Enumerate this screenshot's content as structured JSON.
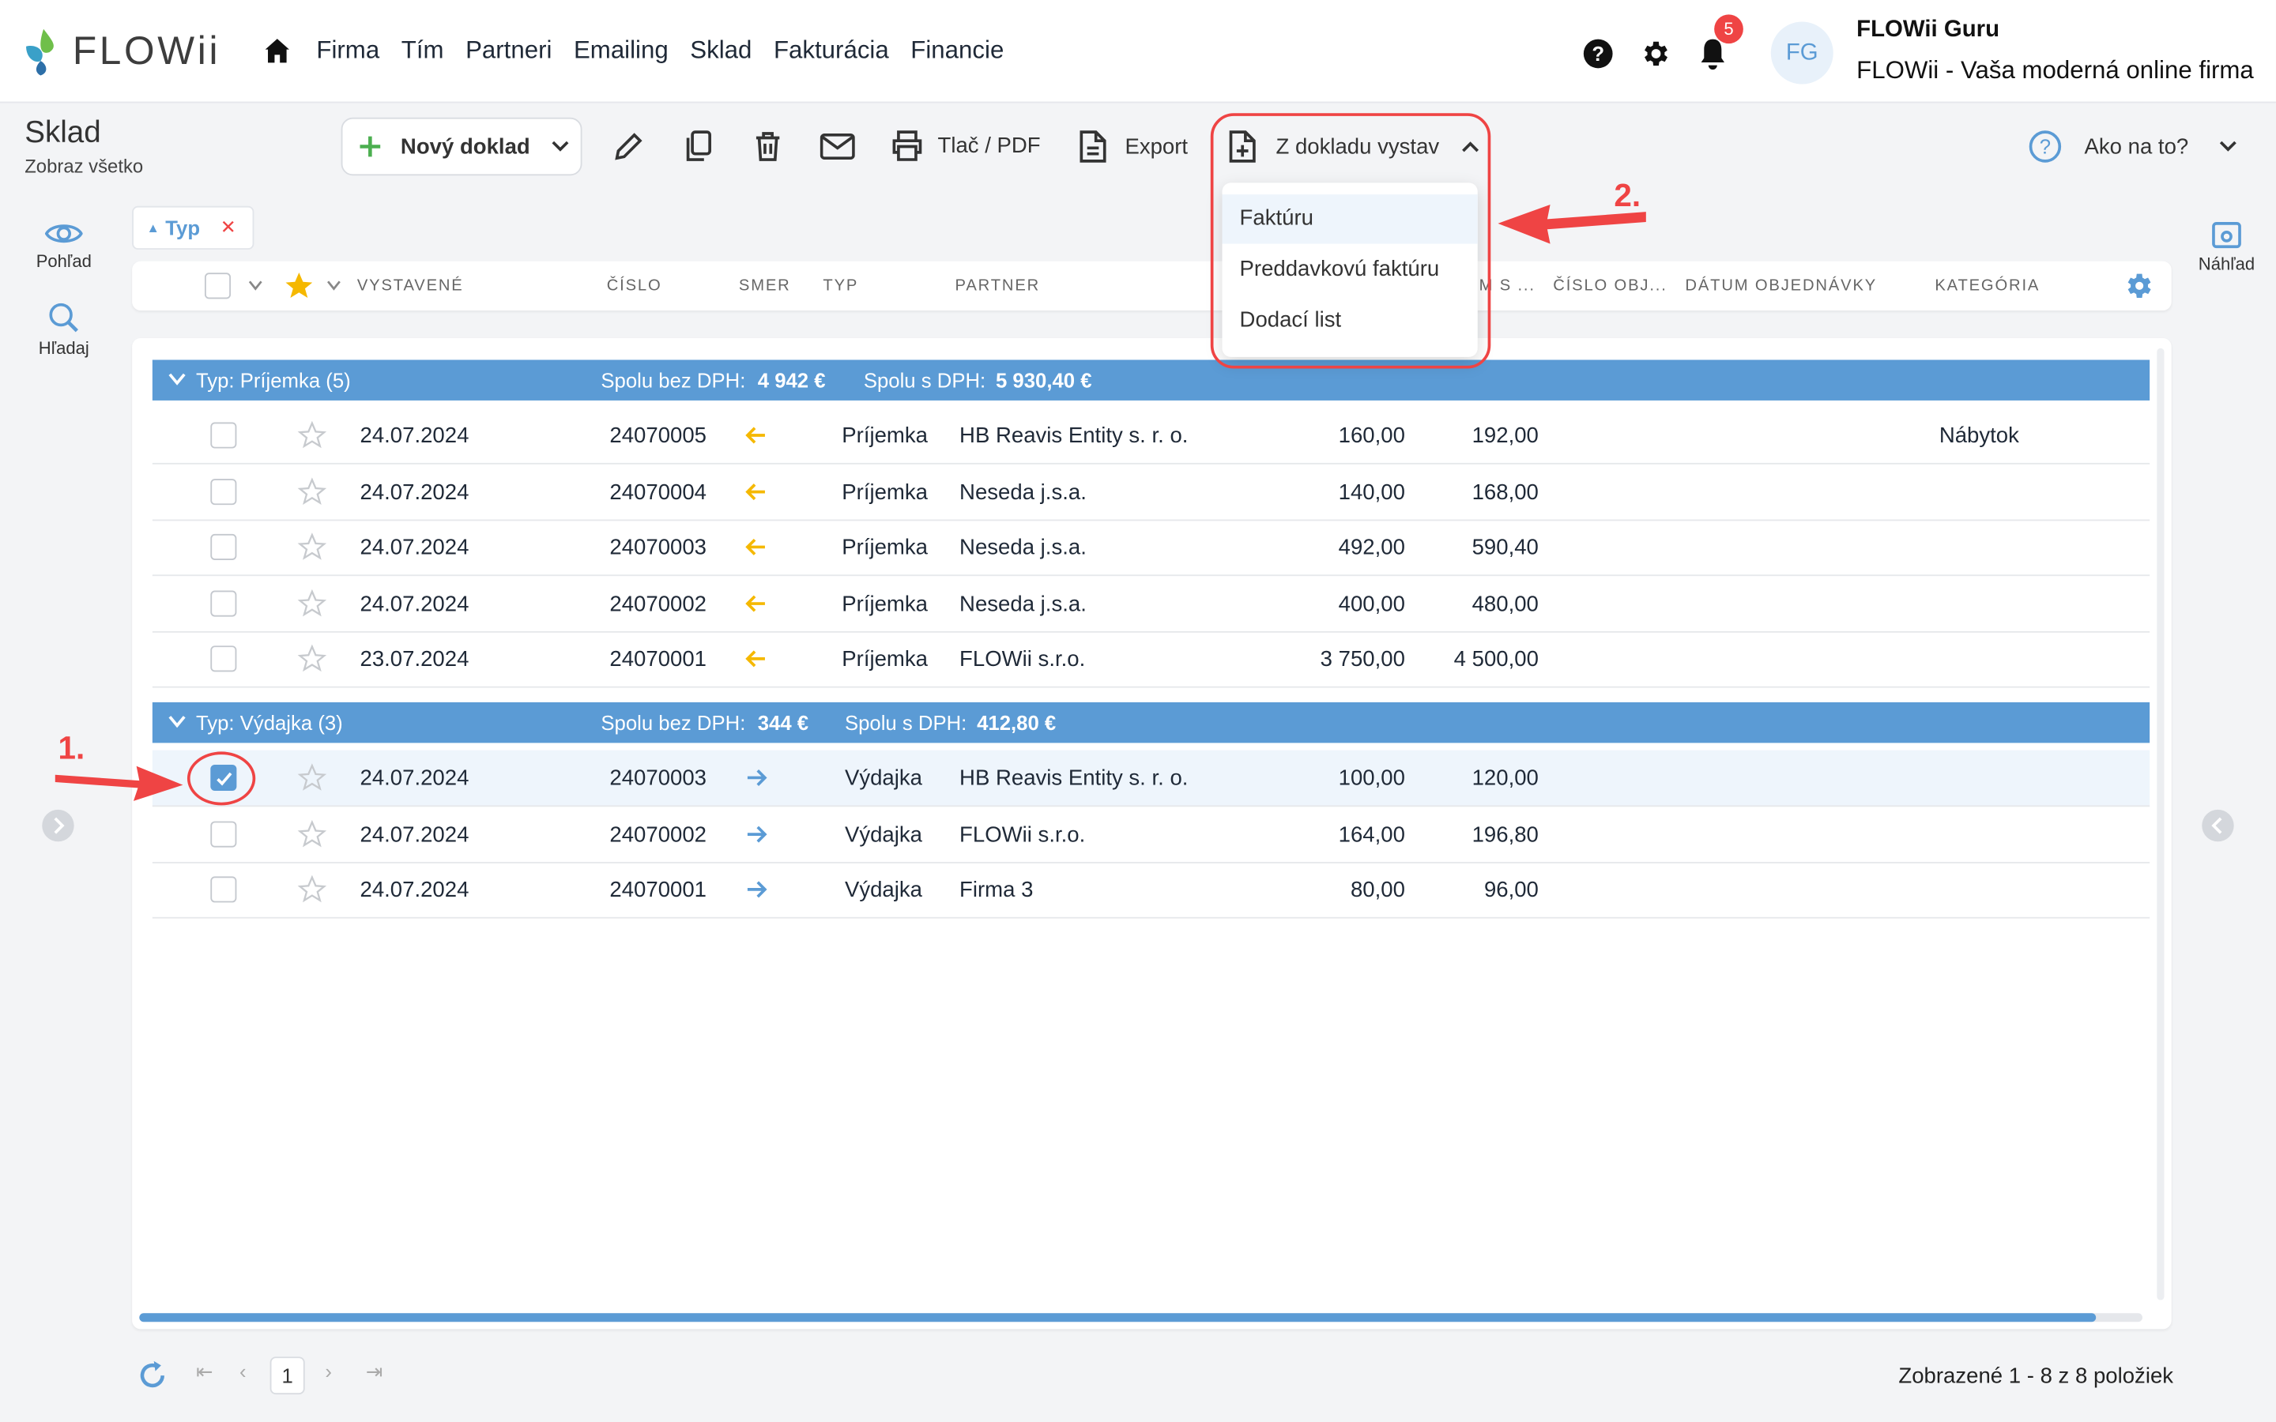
{
  "app": {
    "logo_text": "FLOWii",
    "nav": [
      "Firma",
      "Tím",
      "Partneri",
      "Emailing",
      "Sklad",
      "Fakturácia",
      "Financie"
    ],
    "notifications_count": "5",
    "avatar_initials": "FG",
    "user_name": "FLOWii Guru",
    "user_org": "FLOWii - Vaša moderná online firma"
  },
  "page": {
    "title": "Sklad",
    "subtitle": "Zobraz všetko"
  },
  "toolbar": {
    "new_doc": "Nový doklad",
    "print": "Tlač / PDF",
    "export": "Export",
    "from_doc": "Z dokladu vystav",
    "help": "Ako na to?"
  },
  "dropdown": {
    "items": [
      "Faktúru",
      "Preddavkovú faktúru",
      "Dodací list"
    ]
  },
  "rail": {
    "view": "Pohľad",
    "search": "Hľadaj",
    "preview": "Náhľad"
  },
  "filter_chip": {
    "label": "Typ"
  },
  "columns": {
    "issued": "VYSTAVENÉ",
    "number": "ČÍSLO",
    "direction": "SMER",
    "type": "TYP",
    "partner": "PARTNER",
    "with_vat_trunc": "M S ...",
    "order_no": "ČÍSLO OBJ...",
    "order_date": "DÁTUM OBJEDNÁVKY",
    "category": "KATEGÓRIA"
  },
  "groups": [
    {
      "label": "Typ: Príjemka (5)",
      "sum_no_vat_label": "Spolu bez DPH:",
      "sum_no_vat": "4 942 €",
      "sum_vat_label": "Spolu s DPH:",
      "sum_vat": "5 930,40 €",
      "rows": [
        {
          "date": "24.07.2024",
          "number": "24070005",
          "dir": "in",
          "type": "Príjemka",
          "partner": "HB Reavis Entity s. r. o.",
          "no_vat": "160,00",
          "vat": "192,00",
          "category": "Nábytok",
          "selected": false
        },
        {
          "date": "24.07.2024",
          "number": "24070004",
          "dir": "in",
          "type": "Príjemka",
          "partner": "Neseda j.s.a.",
          "no_vat": "140,00",
          "vat": "168,00",
          "category": "",
          "selected": false
        },
        {
          "date": "24.07.2024",
          "number": "24070003",
          "dir": "in",
          "type": "Príjemka",
          "partner": "Neseda j.s.a.",
          "no_vat": "492,00",
          "vat": "590,40",
          "category": "",
          "selected": false
        },
        {
          "date": "24.07.2024",
          "number": "24070002",
          "dir": "in",
          "type": "Príjemka",
          "partner": "Neseda j.s.a.",
          "no_vat": "400,00",
          "vat": "480,00",
          "category": "",
          "selected": false
        },
        {
          "date": "23.07.2024",
          "number": "24070001",
          "dir": "in",
          "type": "Príjemka",
          "partner": "FLOWii s.r.o.",
          "no_vat": "3 750,00",
          "vat": "4 500,00",
          "category": "",
          "selected": false
        }
      ]
    },
    {
      "label": "Typ: Výdajka (3)",
      "sum_no_vat_label": "Spolu bez DPH:",
      "sum_no_vat": "344 €",
      "sum_vat_label": "Spolu s DPH:",
      "sum_vat": "412,80 €",
      "rows": [
        {
          "date": "24.07.2024",
          "number": "24070003",
          "dir": "out",
          "type": "Výdajka",
          "partner": "HB Reavis Entity s. r. o.",
          "no_vat": "100,00",
          "vat": "120,00",
          "category": "",
          "selected": true
        },
        {
          "date": "24.07.2024",
          "number": "24070002",
          "dir": "out",
          "type": "Výdajka",
          "partner": "FLOWii s.r.o.",
          "no_vat": "164,00",
          "vat": "196,80",
          "category": "",
          "selected": false
        },
        {
          "date": "24.07.2024",
          "number": "24070001",
          "dir": "out",
          "type": "Výdajka",
          "partner": "Firma 3",
          "no_vat": "80,00",
          "vat": "96,00",
          "category": "",
          "selected": false
        }
      ]
    }
  ],
  "annotations": {
    "step1": "1.",
    "step2": "2."
  },
  "pagination": {
    "current_page": "1",
    "info": "Zobrazené 1 - 8 z 8 položiek"
  },
  "colors": {
    "accent": "#5b9bd5",
    "in_arrow": "#f5b800",
    "out_arrow": "#5b9bd5",
    "annotation": "#ef4444"
  }
}
